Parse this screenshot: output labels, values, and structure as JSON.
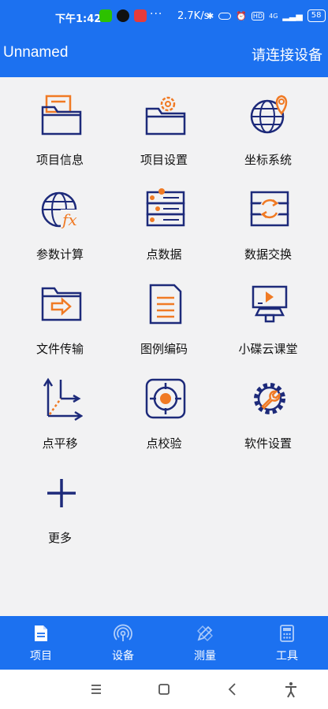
{
  "status": {
    "time": "下午1:42",
    "dots": "···",
    "speed": "2.7K/s",
    "hd": "HD",
    "signal": "4G",
    "battery": "58"
  },
  "header": {
    "title": "Unnamed",
    "connect_label": "请连接设备"
  },
  "grid": [
    {
      "label": "项目信息",
      "icon": "folder-document-icon"
    },
    {
      "label": "项目设置",
      "icon": "folder-gear-icon"
    },
    {
      "label": "坐标系统",
      "icon": "globe-pin-icon"
    },
    {
      "label": "参数计算",
      "icon": "globe-fx-icon"
    },
    {
      "label": "点数据",
      "icon": "server-list-icon"
    },
    {
      "label": "数据交换",
      "icon": "data-exchange-icon"
    },
    {
      "label": "文件传输",
      "icon": "folder-arrow-icon"
    },
    {
      "label": "图例编码",
      "icon": "document-lines-icon"
    },
    {
      "label": "小碟云课堂",
      "icon": "video-class-icon"
    },
    {
      "label": "点平移",
      "icon": "axis-move-icon"
    },
    {
      "label": "点校验",
      "icon": "target-icon"
    },
    {
      "label": "软件设置",
      "icon": "gear-wrench-icon"
    },
    {
      "label": "更多",
      "icon": "plus-icon"
    }
  ],
  "bottom_nav": [
    {
      "label": "项目",
      "icon": "document-icon",
      "active": true
    },
    {
      "label": "设备",
      "icon": "signal-icon",
      "active": false
    },
    {
      "label": "测量",
      "icon": "pen-ruler-icon",
      "active": false
    },
    {
      "label": "工具",
      "icon": "calculator-icon",
      "active": false
    }
  ],
  "colors": {
    "primary": "#1c71f0",
    "icon_navy": "#1d2a7a",
    "icon_orange": "#f07a24",
    "background": "#f2f2f3"
  }
}
